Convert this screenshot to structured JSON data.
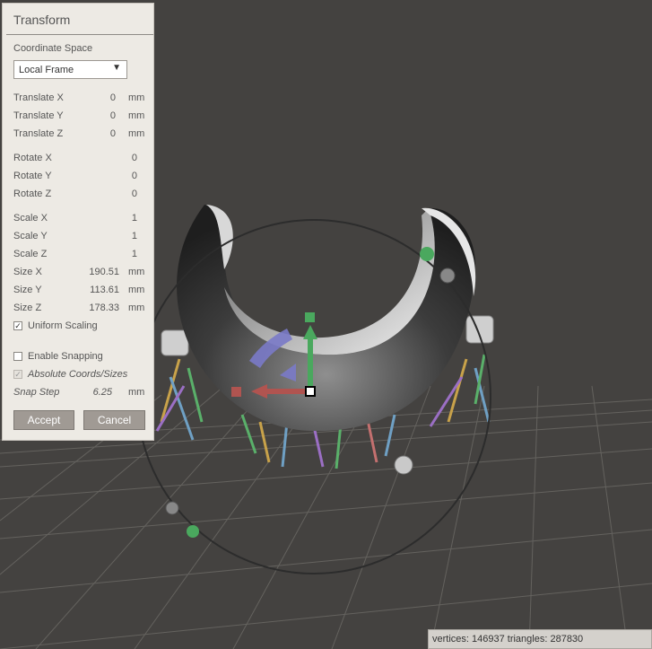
{
  "panel": {
    "title": "Transform",
    "coordinate_space_label": "Coordinate Space",
    "coordinate_space_value": "Local Frame",
    "dropdown_arrow": "▼",
    "fields": [
      {
        "label": "Translate X",
        "value": "0",
        "unit": "mm"
      },
      {
        "label": "Translate Y",
        "value": "0",
        "unit": "mm"
      },
      {
        "label": "Translate Z",
        "value": "0",
        "unit": "mm"
      },
      {
        "label": "Rotate X",
        "value": "0",
        "unit": ""
      },
      {
        "label": "Rotate Y",
        "value": "0",
        "unit": ""
      },
      {
        "label": "Rotate Z",
        "value": "0",
        "unit": ""
      },
      {
        "label": "Scale X",
        "value": "1",
        "unit": ""
      },
      {
        "label": "Scale Y",
        "value": "1",
        "unit": ""
      },
      {
        "label": "Scale Z",
        "value": "1",
        "unit": ""
      },
      {
        "label": "Size X",
        "value": "190.51",
        "unit": "mm"
      },
      {
        "label": "Size Y",
        "value": "113.61",
        "unit": "mm"
      },
      {
        "label": "Size Z",
        "value": "178.33",
        "unit": "mm"
      }
    ],
    "uniform_scaling": {
      "label": "Uniform Scaling",
      "checked": true
    },
    "enable_snapping": {
      "label": "Enable Snapping",
      "checked": false
    },
    "absolute_coords": {
      "label": "Absolute Coords/Sizes",
      "checked": true
    },
    "snap_step": {
      "label": "Snap Step",
      "value": "6.25",
      "unit": "mm"
    },
    "checkmark": "✓",
    "accept_label": "Accept",
    "cancel_label": "Cancel"
  },
  "status_bar": {
    "text": "vertices: 146937 triangles: 287830"
  },
  "colors": {
    "viewport_bg": "#444240",
    "panel_bg": "#edeae4",
    "button_bg": "#a09a94",
    "gizmo_up": "#4aa85e",
    "gizmo_left": "#b05450",
    "gizmo_rotate": "#7a7ac8"
  }
}
